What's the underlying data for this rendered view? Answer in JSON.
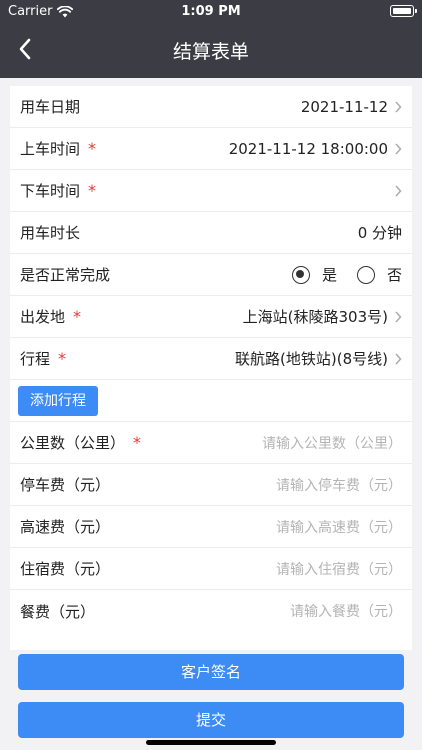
{
  "status_bar": {
    "carrier": "Carrier",
    "time": "1:09 PM"
  },
  "nav": {
    "title": "结算表单"
  },
  "form": {
    "rows": [
      {
        "label": "用车日期",
        "value": "2021-11-12"
      },
      {
        "label": "上车时间",
        "required": "*",
        "value": "2021-11-12 18:00:00"
      },
      {
        "label": "下车时间",
        "required": "*",
        "value": ""
      },
      {
        "label": "用车时长",
        "value": "0 分钟"
      },
      {
        "label": "是否正常完成",
        "options": [
          "是",
          "否"
        ],
        "selected": "是"
      },
      {
        "label": "出发地",
        "required": "*",
        "value": "上海站(秣陵路303号)"
      },
      {
        "label": "行程",
        "required": "*",
        "value": "联航路(地铁站)(8号线)"
      }
    ],
    "add_trip_label": "添加行程",
    "inputs": [
      {
        "label": "公里数（公里）",
        "required": "*",
        "placeholder": "请输入公里数（公里）"
      },
      {
        "label": "停车费（元）",
        "placeholder": "请输入停车费（元）"
      },
      {
        "label": "高速费（元）",
        "placeholder": "请输入高速费（元）"
      },
      {
        "label": "住宿费（元）",
        "placeholder": "请输入住宿费（元）"
      },
      {
        "label": "餐费（元）",
        "placeholder": "请输入餐费（元）"
      }
    ]
  },
  "buttons": {
    "sign_label": "客户签名",
    "submit_label": "提交"
  },
  "colors": {
    "header_bg": "#3b3c44",
    "accent": "#3d8bf5",
    "required": "#e53935"
  },
  "icons": {
    "wifi": "wifi-icon",
    "battery": "battery-icon",
    "back": "back-arrow-icon",
    "chevron": "chevron-right-icon"
  }
}
